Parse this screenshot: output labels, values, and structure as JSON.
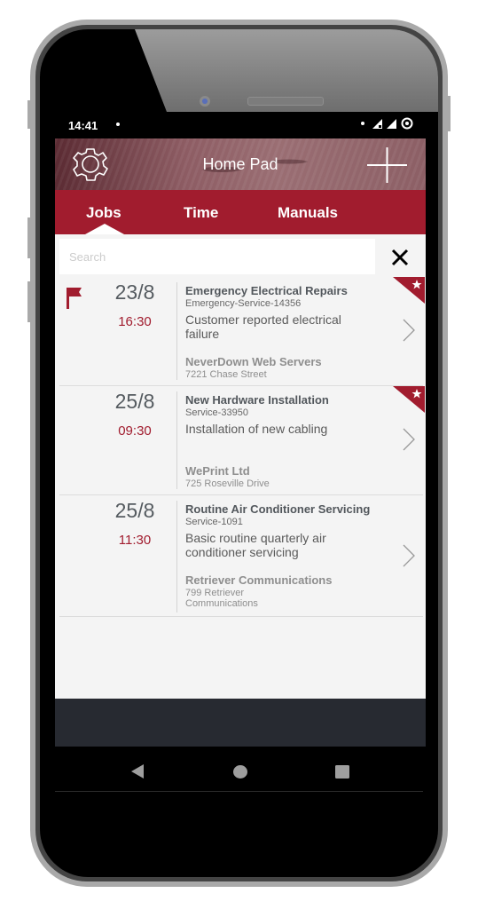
{
  "status_bar": {
    "time": "14:41",
    "icons": [
      "notification-dot-icon",
      "signal-x-icon",
      "signal-icon",
      "data-saver-icon"
    ]
  },
  "header": {
    "title": "Home Pad",
    "left_icon": "gear-icon",
    "right_icon": "plus-icon"
  },
  "tabs": [
    {
      "label": "Jobs",
      "active": true
    },
    {
      "label": "Time",
      "active": false
    },
    {
      "label": "Manuals",
      "active": false
    }
  ],
  "search": {
    "placeholder": "Search",
    "value": "",
    "clear_icon": "close-icon"
  },
  "jobs": [
    {
      "flagged": true,
      "starred": true,
      "date": "23/8",
      "time": "16:30",
      "title": "Emergency Electrical Repairs",
      "code": "Emergency-Service-14356",
      "description": "Customer reported electrical failure",
      "company": "NeverDown Web Servers",
      "address": "7221 Chase Street"
    },
    {
      "flagged": false,
      "starred": true,
      "date": "25/8",
      "time": "09:30",
      "title": "New Hardware Installation",
      "code": "Service-33950",
      "description": "Installation of new cabling",
      "company": "WePrint Ltd",
      "address": "725 Roseville Drive"
    },
    {
      "flagged": false,
      "starred": false,
      "date": "25/8",
      "time": "11:30",
      "title": "Routine Air Conditioner Servicing",
      "code": "Service-1091",
      "description": "Basic routine quarterly air conditioner servicing",
      "company": "Retriever Communications",
      "address": "799 Retriever Communications"
    }
  ],
  "nav_bar": {
    "back": "back-triangle-icon",
    "home": "home-circle-icon",
    "recents": "recents-square-icon"
  },
  "colors": {
    "accent": "#a11c2e",
    "background": "#f4f4f4",
    "footer": "#272a31"
  }
}
